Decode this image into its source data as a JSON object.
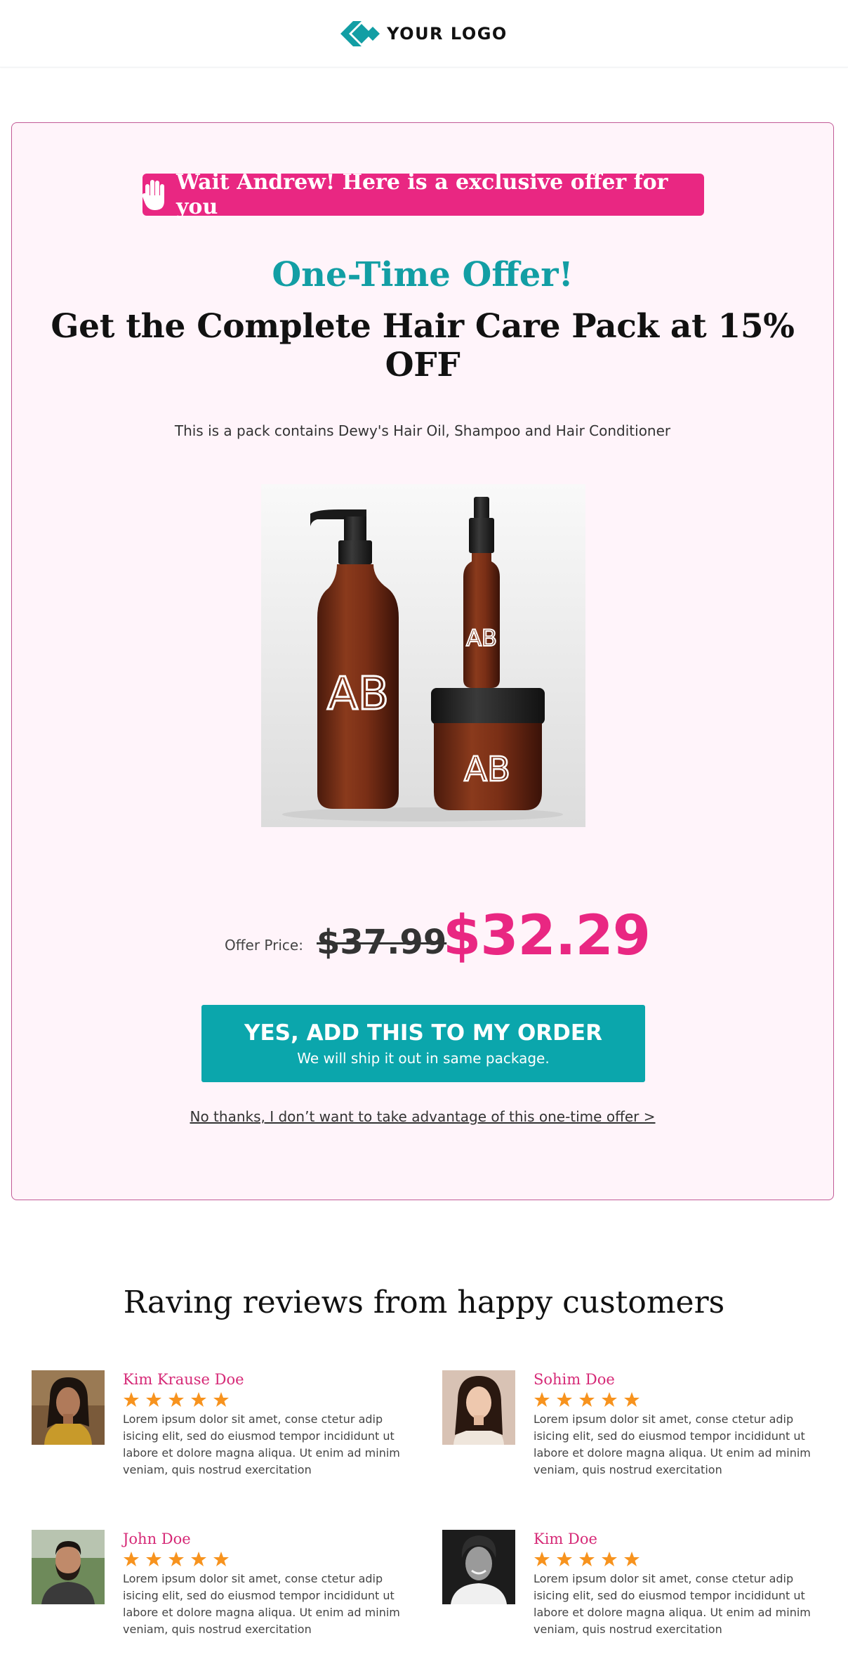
{
  "header": {
    "logo_text": "YOUR LOGO",
    "logo_icon": "diamond-chevrons-icon",
    "brand_color": "#129ea4"
  },
  "offer": {
    "wait_text": "Wait Andrew! Here is a exclusive offer for you",
    "wait_icon": "hand-stop-icon",
    "one_time_title": "One-Time Offer!",
    "headline": "Get the Complete Hair Care Pack at 15% OFF",
    "subline": "This is a pack contains Dewy's Hair Oil, Shampoo and Hair Conditioner",
    "product_image_label": "AB",
    "price_label": "Offer Price:",
    "old_price": "$37.99",
    "new_price": "$32.29",
    "cta_main": "YES, ADD THIS TO MY ORDER",
    "cta_sub": "We will ship it out in same package.",
    "decline_link": "No thanks, I don’t want to take advantage of this one-time offer >"
  },
  "colors": {
    "accent_pink": "#e92782",
    "accent_teal": "#0ba6ac",
    "box_background": "#fff4fa",
    "star": "#f7931e"
  },
  "reviews": {
    "title": "Raving reviews from happy customers",
    "items": [
      {
        "name": "Kim Krause Doe",
        "rating": 5,
        "text": "Lorem ipsum dolor sit amet, conse ctetur adip isicing elit, sed do eiusmod tempor incididunt ut labore et dolore magna aliqua. Ut enim ad minim veniam, quis nostrud exercitation"
      },
      {
        "name": "Sohim Doe",
        "rating": 5,
        "text": "Lorem ipsum dolor sit amet, conse ctetur adip isicing elit, sed do eiusmod tempor incididunt ut labore et dolore magna aliqua. Ut enim ad minim veniam, quis nostrud exercitation"
      },
      {
        "name": "John Doe",
        "rating": 5,
        "text": "Lorem ipsum dolor sit amet, conse ctetur adip isicing elit, sed do eiusmod tempor incididunt ut labore et dolore magna aliqua. Ut enim ad minim veniam, quis nostrud exercitation"
      },
      {
        "name": "Kim Doe",
        "rating": 5,
        "text": "Lorem ipsum dolor sit amet, conse ctetur adip isicing elit, sed do eiusmod tempor incididunt ut labore et dolore magna aliqua. Ut enim ad minim veniam, quis nostrud exercitation"
      }
    ]
  }
}
